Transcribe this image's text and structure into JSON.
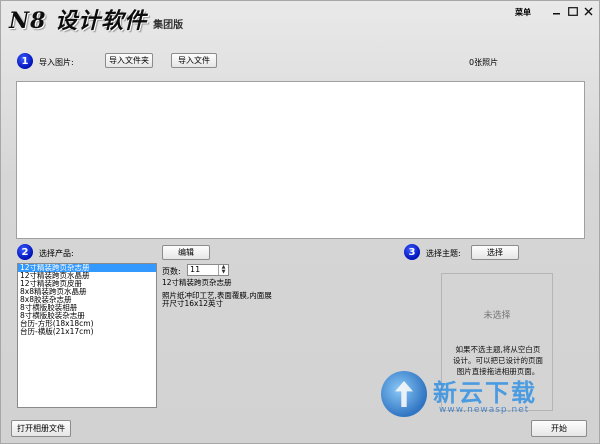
{
  "app": {
    "logo_main": "N8 设计软件",
    "logo_sub": "集团版",
    "menu_label": "菜单"
  },
  "step1": {
    "number": "1",
    "label": "导入图片:",
    "import_folder": "导入文件夹",
    "import_file": "导入文件",
    "photo_count": "0张照片"
  },
  "step2": {
    "number": "2",
    "label": "选择产品:",
    "edit_button": "编辑",
    "products": [
      "12寸精装跨页杂志册",
      "12寸精装跨页水晶册",
      "12寸精装跨页皮册",
      "8x8精装跨页水晶册",
      "8x8胶装杂志册",
      "8寸横版胶装相册",
      "8寸横版胶装杂志册",
      "台历-方形(18x18cm)",
      "台历-横版(21x17cm)"
    ],
    "selected_index": 0,
    "pages_label": "页数:",
    "pages_value": "11",
    "desc_lines": [
      "12寸精装跨页杂志册",
      "",
      "照片纸冲印工艺,表面覆膜,内面展",
      "开尺寸16x12英寸"
    ]
  },
  "step3": {
    "number": "3",
    "label": "选择主题:",
    "select_button": "选择",
    "none_selected": "未选择",
    "tip_lines": [
      "如果不选主题,将从空白页",
      "设计。可以把已设计的页面",
      "图片直接拖进相册页面。"
    ]
  },
  "footer": {
    "open_album": "打开相册文件",
    "start": "开始"
  },
  "watermark": {
    "text": "新云下载",
    "url": "www.newasp.net"
  }
}
